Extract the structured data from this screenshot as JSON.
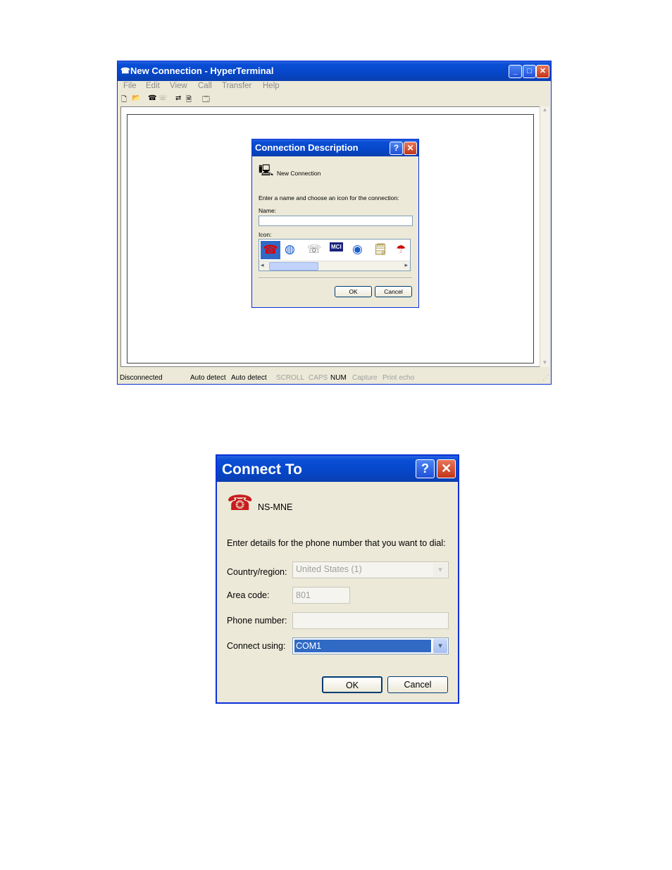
{
  "hyperterminal": {
    "title": "New Connection - HyperTerminal",
    "menu": [
      "File",
      "Edit",
      "View",
      "Call",
      "Transfer",
      "Help"
    ],
    "status": {
      "connection": "Disconnected",
      "detect1": "Auto detect",
      "detect2": "Auto detect",
      "scroll": "SCROLL",
      "caps": "CAPS",
      "num": "NUM",
      "capture": "Capture",
      "printecho": "Print echo"
    }
  },
  "connection_description": {
    "title": "Connection Description",
    "header_name": "New Connection",
    "instruction": "Enter a name and choose an icon for the connection:",
    "name_label": "Name:",
    "name_value": "",
    "icon_label": "Icon:",
    "icons": [
      "red-phone-icon",
      "globe-phone-icon",
      "modem-icon",
      "mci-icon",
      "world-phone-icon",
      "document-phone-icon",
      "red-satellite-icon"
    ],
    "ok": "OK",
    "cancel": "Cancel"
  },
  "connect_to": {
    "title": "Connect To",
    "header_name": "NS-MNE",
    "instruction": "Enter details for the phone number that you want to dial:",
    "country_label": "Country/region:",
    "country_value": "United States (1)",
    "area_label": "Area code:",
    "area_value": "801",
    "phone_label": "Phone number:",
    "phone_value": "",
    "connect_label": "Connect using:",
    "connect_value": "COM1",
    "ok": "OK",
    "cancel": "Cancel"
  },
  "colors": {
    "xp_title_blue": "#0a4fd6",
    "dialog_face": "#ece9d8",
    "selection_blue": "#316ac5",
    "close_red": "#c2351a"
  }
}
